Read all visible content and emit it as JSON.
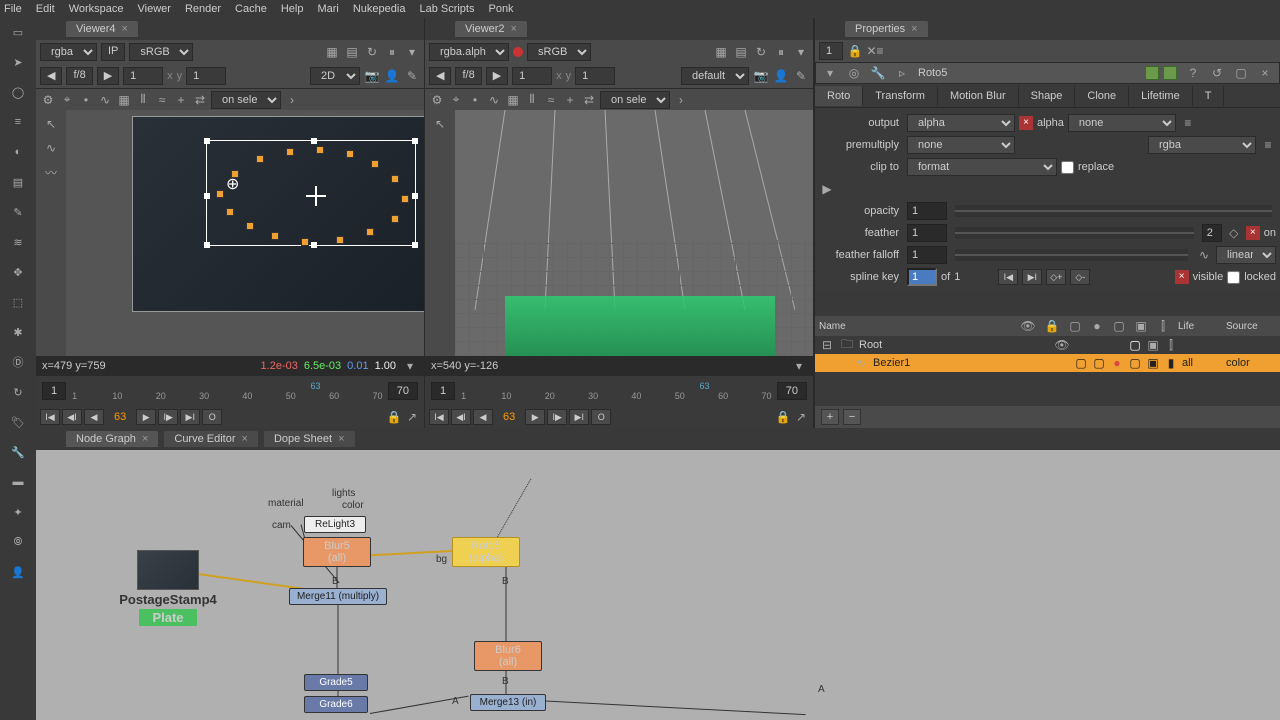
{
  "menu": [
    "File",
    "Edit",
    "Workspace",
    "Viewer",
    "Render",
    "Cache",
    "Help",
    "Mari",
    "Nukepedia",
    "Lab Scripts",
    "Ponk"
  ],
  "viewer1": {
    "tab": "Viewer4",
    "channel": "rgba",
    "ip": "IP",
    "colorspace": "sRGB",
    "frac": "f/8",
    "xval": "1",
    "yval": "1",
    "dim": "2D",
    "selbox": "on selec",
    "coord": "x=479 y=759",
    "rgba_r": "1.2e-03",
    "rgba_g": "6.5e-03",
    "rgba_b": "0.01",
    "rgba_a": "1.00",
    "timeline_start": "1",
    "timeline_end": "70",
    "cur_frame": "63",
    "marker": "63"
  },
  "viewer2": {
    "tab": "Viewer2",
    "channel": "rgba.alpha",
    "colorspace": "sRGB",
    "frac": "f/8",
    "xval": "1",
    "yval": "1",
    "dim": "default",
    "selbox": "on selec",
    "coord": "x=540 y=-126",
    "timeline_start": "1",
    "timeline_end": "70",
    "cur_frame": "63",
    "marker": "63"
  },
  "timeline_ticks": [
    "1",
    "10",
    "20",
    "30",
    "40",
    "50",
    "60",
    "70"
  ],
  "nodegraph": {
    "tabs": [
      "Node Graph",
      "Curve Editor",
      "Dope Sheet"
    ],
    "postage": {
      "name": "PostageStamp4",
      "plate": "Plate"
    },
    "labels": {
      "material": "material",
      "lights": "lights",
      "color": "color",
      "cam": "cam",
      "bg": "bg",
      "A": "A",
      "B": "B"
    },
    "nodes": {
      "relight": "ReLight3",
      "blur5": "Blur5",
      "blur5_sub": "(all)",
      "roto5": "Roto5",
      "roto5_sub": "(alpha)",
      "merge11": "Merge11 (multiply)",
      "grade5": "Grade5",
      "grade6": "Grade6",
      "blur6": "Blur6",
      "blur6_sub": "(all)",
      "merge13": "Merge13 (in)"
    }
  },
  "properties": {
    "tab": "Properties",
    "lock_num": "1",
    "node_name": "Roto5",
    "tabs": [
      "Roto",
      "Transform",
      "Motion Blur",
      "Shape",
      "Clone",
      "Lifetime",
      "T"
    ],
    "output": {
      "label": "output",
      "value": "alpha",
      "clip": "alpha",
      "mask": "none"
    },
    "premultiply": {
      "label": "premultiply",
      "value": "none",
      "mask": "rgba"
    },
    "clipto": {
      "label": "clip to",
      "value": "format",
      "replace": "replace"
    },
    "opacity": {
      "label": "opacity",
      "value": "1"
    },
    "feather": {
      "label": "feather",
      "value": "1",
      "two": "2",
      "on": "on"
    },
    "falloff": {
      "label": "feather falloff",
      "value": "1",
      "curve": "linear"
    },
    "splinekey": {
      "label": "spline key",
      "value": "1",
      "of": "of",
      "total": "1",
      "visible": "visible",
      "locked": "locked"
    },
    "tree_cols": {
      "name": "Name",
      "life": "Life",
      "source": "Source"
    },
    "tree": {
      "root": "Root",
      "bez": "Bezier1",
      "all": "all",
      "color": "color"
    }
  }
}
